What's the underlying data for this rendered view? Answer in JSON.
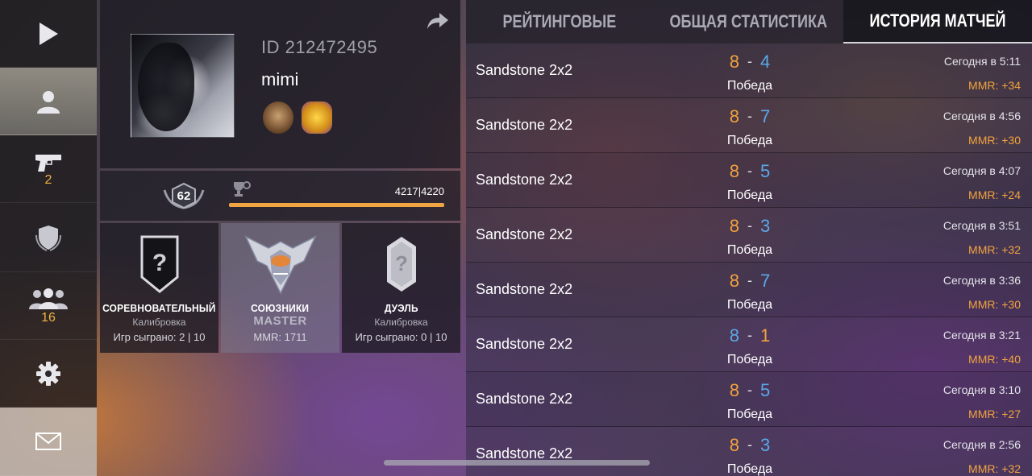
{
  "colors": {
    "accent_orange": "#f2a33e",
    "accent_blue": "#5aa8e8",
    "score_orange": "#f2a33e",
    "score_blue": "#5aa8e8"
  },
  "sidebar": {
    "items": [
      {
        "icon": "play-icon",
        "count": ""
      },
      {
        "icon": "profile-icon",
        "count": ""
      },
      {
        "icon": "pistol-icon",
        "count": "2"
      },
      {
        "icon": "clan-shield-icon",
        "count": ""
      },
      {
        "icon": "friends-icon",
        "count": "16"
      },
      {
        "icon": "gear-icon",
        "count": ""
      },
      {
        "icon": "mail-icon",
        "count": ""
      }
    ]
  },
  "profile": {
    "id_text": "ID 212472495",
    "name": "mimi",
    "level": "62",
    "xp_text": "4217|4220",
    "xp_progress": 0.9993
  },
  "modes": [
    {
      "title": "СОРЕВНОВАТЕЛЬНЫЙ",
      "rank": "",
      "sub": "Калибровка",
      "games": "Игр сыграно: 2 | 10"
    },
    {
      "title": "СОЮЗНИКИ",
      "rank": "MASTER",
      "sub": "",
      "games": "MMR: 1711"
    },
    {
      "title": "ДУЭЛЬ",
      "rank": "",
      "sub": "Калибровка",
      "games": "Игр сыграно: 0 | 10"
    }
  ],
  "tabs": [
    "РЕЙТИНГОВЫЕ",
    "ОБЩАЯ СТАТИСТИКА",
    "ИСТОРИЯ МАТЧЕЙ"
  ],
  "matches": [
    {
      "map": "Sandstone 2x2",
      "score_left": "8",
      "score_right": "4",
      "left_color": "orange",
      "right_color": "blue",
      "result": "Победа",
      "time": "Сегодня в 5:11",
      "mmr": "MMR: +34"
    },
    {
      "map": "Sandstone 2x2",
      "score_left": "8",
      "score_right": "7",
      "left_color": "orange",
      "right_color": "blue",
      "result": "Победа",
      "time": "Сегодня в 4:56",
      "mmr": "MMR: +30"
    },
    {
      "map": "Sandstone 2x2",
      "score_left": "8",
      "score_right": "5",
      "left_color": "orange",
      "right_color": "blue",
      "result": "Победа",
      "time": "Сегодня в 4:07",
      "mmr": "MMR: +24"
    },
    {
      "map": "Sandstone 2x2",
      "score_left": "8",
      "score_right": "3",
      "left_color": "orange",
      "right_color": "blue",
      "result": "Победа",
      "time": "Сегодня в 3:51",
      "mmr": "MMR: +32"
    },
    {
      "map": "Sandstone 2x2",
      "score_left": "8",
      "score_right": "7",
      "left_color": "orange",
      "right_color": "blue",
      "result": "Победа",
      "time": "Сегодня в 3:36",
      "mmr": "MMR: +30"
    },
    {
      "map": "Sandstone 2x2",
      "score_left": "8",
      "score_right": "1",
      "left_color": "blue",
      "right_color": "orange",
      "result": "Победа",
      "time": "Сегодня в 3:21",
      "mmr": "MMR: +40"
    },
    {
      "map": "Sandstone 2x2",
      "score_left": "8",
      "score_right": "5",
      "left_color": "orange",
      "right_color": "blue",
      "result": "Победа",
      "time": "Сегодня в 3:10",
      "mmr": "MMR: +27"
    },
    {
      "map": "Sandstone 2x2",
      "score_left": "8",
      "score_right": "3",
      "left_color": "orange",
      "right_color": "blue",
      "result": "Победа",
      "time": "Сегодня в 2:56",
      "mmr": "MMR: +32"
    }
  ]
}
